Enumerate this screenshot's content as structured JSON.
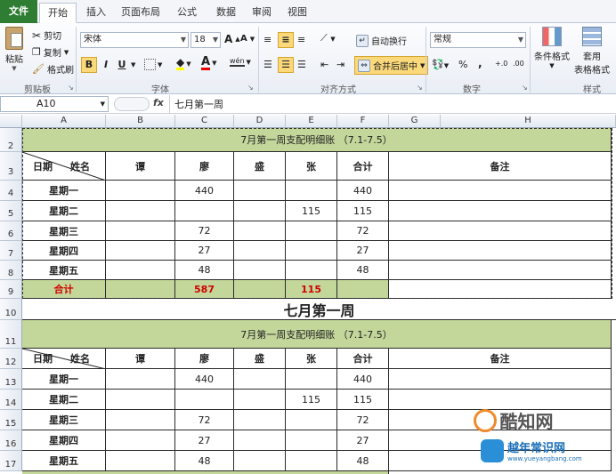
{
  "ribbon": {
    "tabs": [
      "文件",
      "开始",
      "插入",
      "页面布局",
      "公式",
      "数据",
      "审阅",
      "视图"
    ],
    "clipboard": {
      "paste": "粘贴",
      "cut": "剪切",
      "copy": "复制",
      "format_painter": "格式刷",
      "label": "剪贴板"
    },
    "font": {
      "name": "宋体",
      "size": "18",
      "grow": "A",
      "shrink": "A",
      "bold": "B",
      "italic": "I",
      "underline": "U",
      "phonetic": "wén",
      "label": "字体"
    },
    "alignment": {
      "wrap": "自动换行",
      "merge": "合并后居中",
      "label": "对齐方式"
    },
    "number": {
      "format": "常规",
      "percent": "%",
      "comma": ",",
      "inc_decimal": "+.0",
      "dec_decimal": ".00",
      "label": "数字"
    },
    "styles": {
      "conditional": "条件格式",
      "table_format_1": "套用",
      "table_format_2": "表格格式",
      "label": "样式"
    }
  },
  "formula_bar": {
    "name_box": "A10",
    "fx": "fx",
    "content": "七月第一周"
  },
  "columns": [
    "A",
    "B",
    "C",
    "D",
    "E",
    "F",
    "G",
    "H"
  ],
  "rows": [
    "2",
    "3",
    "4",
    "5",
    "6",
    "7",
    "8",
    "9",
    "10",
    "11",
    "12",
    "13",
    "14",
    "15",
    "16",
    "17"
  ],
  "table1": {
    "title": "7月第一周支配明细账 （7.1-7.5）",
    "header": {
      "date": "日期",
      "name": "姓名",
      "col_b": "谭",
      "col_c": "廖",
      "col_d": "盛",
      "col_e": "张",
      "total": "合计",
      "note": "备注"
    },
    "rows": [
      {
        "day": "星期一",
        "b": "",
        "c": "440",
        "d": "",
        "e": "",
        "f": "440"
      },
      {
        "day": "星期二",
        "b": "",
        "c": "",
        "d": "",
        "e": "115",
        "f": "115"
      },
      {
        "day": "星期三",
        "b": "",
        "c": "72",
        "d": "",
        "e": "",
        "f": "72"
      },
      {
        "day": "星期四",
        "b": "",
        "c": "27",
        "d": "",
        "e": "",
        "f": "27"
      },
      {
        "day": "星期五",
        "b": "",
        "c": "48",
        "d": "",
        "e": "",
        "f": "48"
      }
    ],
    "totals": {
      "label": "合计",
      "c": "587",
      "e": "115"
    }
  },
  "week_title": "七月第一周",
  "table2": {
    "title": "7月第一周支配明细账 （7.1-7.5）",
    "header": {
      "date": "日期",
      "name": "姓名",
      "col_b": "谭",
      "col_c": "廖",
      "col_d": "盛",
      "col_e": "张",
      "total": "合计",
      "note": "备注"
    },
    "rows": [
      {
        "day": "星期一",
        "b": "",
        "c": "440",
        "d": "",
        "e": "",
        "f": "440"
      },
      {
        "day": "星期二",
        "b": "",
        "c": "",
        "d": "",
        "e": "115",
        "f": "115"
      },
      {
        "day": "星期三",
        "b": "",
        "c": "72",
        "d": "",
        "e": "",
        "f": "72"
      },
      {
        "day": "星期四",
        "b": "",
        "c": "27",
        "d": "",
        "e": "",
        "f": "27"
      },
      {
        "day": "星期五",
        "b": "",
        "c": "48",
        "d": "",
        "e": "",
        "f": "48"
      }
    ]
  },
  "watermark": {
    "brand": "酷知网",
    "site_name": "越年常识网",
    "url": "www.yueyangbang.com"
  },
  "colors": {
    "accent": "#2e7d32",
    "table_fill": "#c4d79b",
    "total_red": "#d00000"
  }
}
